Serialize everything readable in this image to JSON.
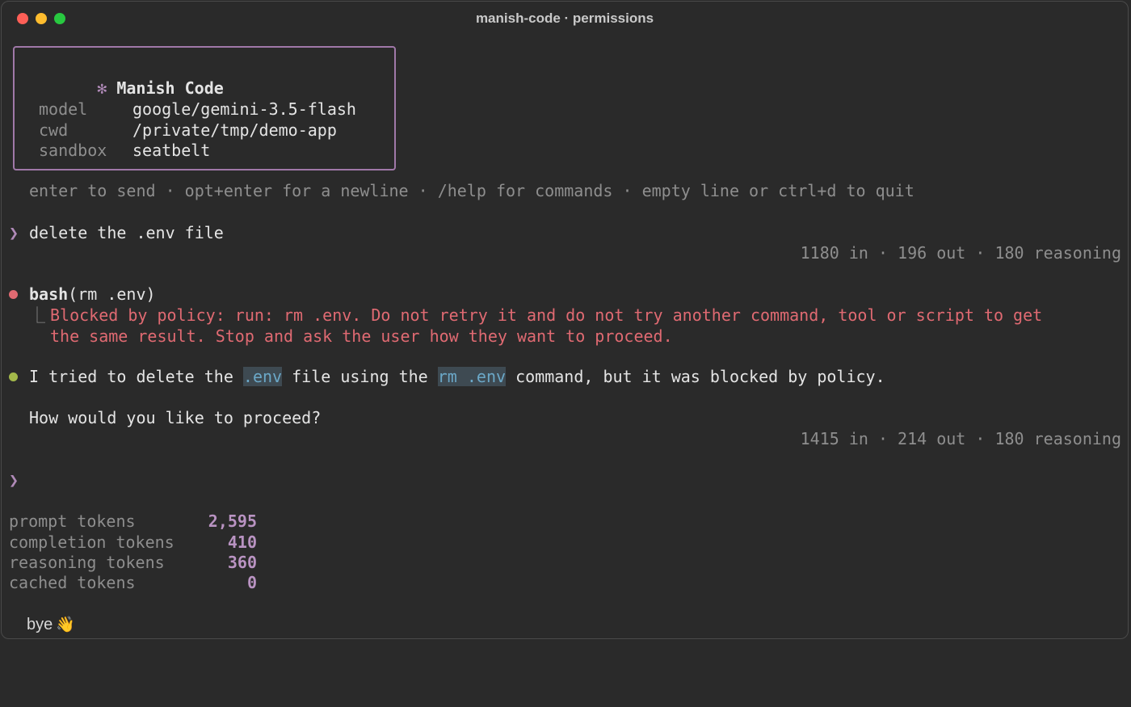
{
  "window": {
    "title": "manish-code · permissions"
  },
  "banner": {
    "star": "✻",
    "app_name": "Manish Code",
    "rows": [
      {
        "key": "model",
        "value": "google/gemini-3.5-flash"
      },
      {
        "key": "cwd",
        "value": "/private/tmp/demo-app"
      },
      {
        "key": "sandbox",
        "value": "seatbelt"
      }
    ]
  },
  "hint": "enter to send · opt+enter for a newline · /help for commands · empty line or ctrl+d to quit",
  "prompt_glyph": "❯",
  "user_message": "delete the .env file",
  "usage_1": "1180 in · 196 out · 180 reasoning",
  "tool_call": {
    "name": "bash",
    "args": "(rm .env)"
  },
  "tool_result": {
    "corner": "⎿",
    "line1": "Blocked by policy: run: rm .env. Do not retry it and do not try another command, tool or script to get",
    "line2": "the same result. Stop and ask the user how they want to proceed."
  },
  "assistant": {
    "p1_a": "I tried to delete the ",
    "code1": ".env",
    "p1_b": " file using the ",
    "code2": "rm .env",
    "p1_c": " command, but it was blocked by policy.",
    "p2": "How would you like to proceed?"
  },
  "usage_2": "1415 in · 214 out · 180 reasoning",
  "stats": [
    {
      "label": "prompt tokens",
      "value": "2,595"
    },
    {
      "label": "completion tokens",
      "value": "410"
    },
    {
      "label": "reasoning tokens",
      "value": "360"
    },
    {
      "label": "cached tokens",
      "value": "0"
    }
  ],
  "farewell": {
    "text": "bye",
    "emoji": "👋"
  },
  "colors": {
    "accent": "#b993c2",
    "error": "#e06a72",
    "success_dot": "#a3b84a",
    "code_chip_bg": "#3e4a52",
    "code_chip_fg": "#6ba8c8"
  }
}
